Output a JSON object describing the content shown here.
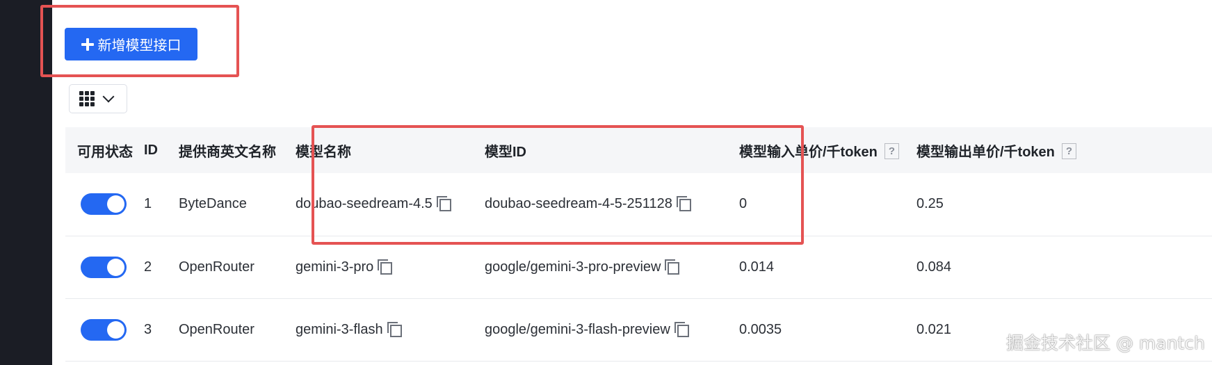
{
  "toolbar": {
    "add_button_label": "新增模型接口",
    "column_settings": {
      "icon": "grid-icon",
      "dropdown_icon": "chevron-down-icon"
    }
  },
  "table": {
    "headers": {
      "status": "可用状态",
      "id": "ID",
      "provider": "提供商英文名称",
      "model_name": "模型名称",
      "model_id": "模型ID",
      "input_price": "模型输入单价/千token",
      "output_price": "模型输出单价/千token",
      "help_symbol": "?"
    },
    "rows": [
      {
        "enabled": true,
        "id": "1",
        "provider": "ByteDance",
        "model_name": "doubao-seedream-4.5",
        "model_id": "doubao-seedream-4-5-251128",
        "input_price": "0",
        "output_price": "0.25"
      },
      {
        "enabled": true,
        "id": "2",
        "provider": "OpenRouter",
        "model_name": "gemini-3-pro",
        "model_id": "google/gemini-3-pro-preview",
        "input_price": "0.014",
        "output_price": "0.084"
      },
      {
        "enabled": true,
        "id": "3",
        "provider": "OpenRouter",
        "model_name": "gemini-3-flash",
        "model_id": "google/gemini-3-flash-preview",
        "input_price": "0.0035",
        "output_price": "0.021"
      }
    ]
  },
  "watermark": "掘金技术社区 @ mantch",
  "colors": {
    "primary": "#2468f2",
    "highlight": "#e55353",
    "sidebar": "#1b1d25",
    "header_bg": "#f5f6f8"
  }
}
